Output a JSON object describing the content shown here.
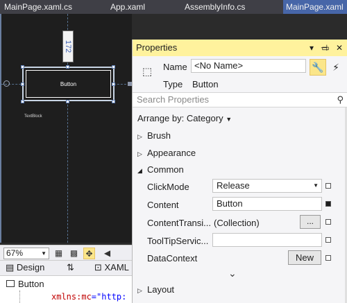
{
  "tabs": [
    "MainPage.xaml.cs",
    "App.xaml",
    "AssemblyInfo.cs",
    "MainPage.xaml"
  ],
  "designer": {
    "measure": "172",
    "button_text": "Button",
    "textblock_text": "TextBlock",
    "zoom": "67%"
  },
  "view_tabs": {
    "design": "Design",
    "swap": "⇅",
    "xaml": "XAML"
  },
  "element_selector": "Button",
  "code_line": {
    "attr": "xmlns:mc",
    "eq": "=",
    "value": "\"http:"
  },
  "properties": {
    "title": "Properties",
    "name_label": "Name",
    "name_value": "<No Name>",
    "type_label": "Type",
    "type_value": "Button",
    "search_placeholder": "Search Properties",
    "arrange_by": "Arrange by: Category",
    "categories": {
      "brush": "Brush",
      "appearance": "Appearance",
      "common": "Common",
      "layout": "Layout"
    },
    "rows": {
      "clickmode_label": "ClickMode",
      "clickmode_value": "Release",
      "content_label": "Content",
      "content_value": "Button",
      "contenttrans_label": "ContentTransi...",
      "contenttrans_value": "(Collection)",
      "ellipsis": "...",
      "tooltip_label": "ToolTipServic...",
      "datacontext_label": "DataContext",
      "new_label": "New"
    }
  },
  "icons": {
    "title_dropdown": "▾",
    "pin": "⊣",
    "maximize": "▭",
    "close": "✕",
    "wrench": "🔧",
    "lightning": "⚡",
    "search": "⚲",
    "chevron_down": "⌄"
  },
  "colors": {
    "accent_tab": "#4766a8",
    "panel_title_bg": "#fff29d",
    "toggle_bg": "#fbe68a"
  }
}
